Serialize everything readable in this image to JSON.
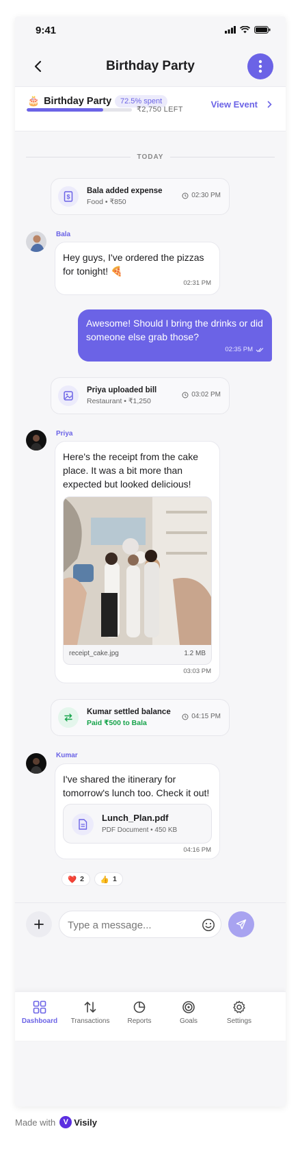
{
  "status_bar": {
    "time": "9:41"
  },
  "header": {
    "title": "Birthday Party",
    "back_icon": "chevron-left-icon",
    "more_icon": "more-vertical-icon"
  },
  "event_summary": {
    "emoji": "🎂",
    "name": "Birthday Party",
    "spent_label": "72.5% spent",
    "spent_fraction": 0.725,
    "remaining_label": "₹2,750 LEFT",
    "view_event_label": "View Event",
    "accent": "#6b63e6"
  },
  "chat": {
    "day_divider": "TODAY",
    "system_events": [
      {
        "icon": "receipt-icon",
        "title": "Bala added expense",
        "subtitle": "Food • ₹850",
        "time": "02:30 PM"
      },
      {
        "icon": "image-icon",
        "title": "Priya uploaded bill",
        "subtitle": "Restaurant • ₹1,250",
        "time": "03:02 PM"
      },
      {
        "icon": "transfer-icon",
        "title": "Kumar settled balance",
        "subtitle": "Paid ₹500 to Bala",
        "time": "04:15 PM",
        "subtitle_color": "#16a34a"
      }
    ],
    "messages": [
      {
        "sender": "Bala",
        "lines": [
          "Hey guys, I've ordered the pizzas",
          "for tonight! 🍕"
        ],
        "time": "02:31 PM"
      },
      {
        "sender": "You",
        "lines": [
          "Awesome! Should I bring the drinks or did",
          "someone else grab those?"
        ],
        "time": "02:35 PM",
        "status_icon": "double-check-icon"
      },
      {
        "sender": "Priya",
        "lines": [
          "Here's the receipt from the cake",
          "place. It was a bit more than",
          "expected but looked delicious!"
        ],
        "time": "03:03 PM",
        "attachment": {
          "file_name": "receipt_cake.jpg",
          "file_size": "1.2 MB"
        }
      },
      {
        "sender": "Kumar",
        "lines": [
          "I've shared the itinerary for",
          "tomorrow's lunch too. Check it out!"
        ],
        "time": "04:16 PM",
        "attachment": {
          "file_name": "Lunch_Plan.pdf",
          "file_meta": "PDF Document • 450 KB"
        }
      }
    ],
    "reactions": [
      {
        "emoji": "❤️",
        "count": "2"
      },
      {
        "emoji": "👍",
        "count": "1"
      }
    ]
  },
  "composer": {
    "placeholder": "Type a message..."
  },
  "tabs": [
    {
      "label": "Dashboard",
      "icon": "grid-icon",
      "active": true
    },
    {
      "label": "Transactions",
      "icon": "arrows-updown-icon",
      "active": false
    },
    {
      "label": "Reports",
      "icon": "pie-chart-icon",
      "active": false
    },
    {
      "label": "Goals",
      "icon": "target-icon",
      "active": false
    },
    {
      "label": "Settings",
      "icon": "gear-icon",
      "active": false
    }
  ],
  "footer": {
    "made_with": "Made with",
    "brand": "Visily"
  }
}
